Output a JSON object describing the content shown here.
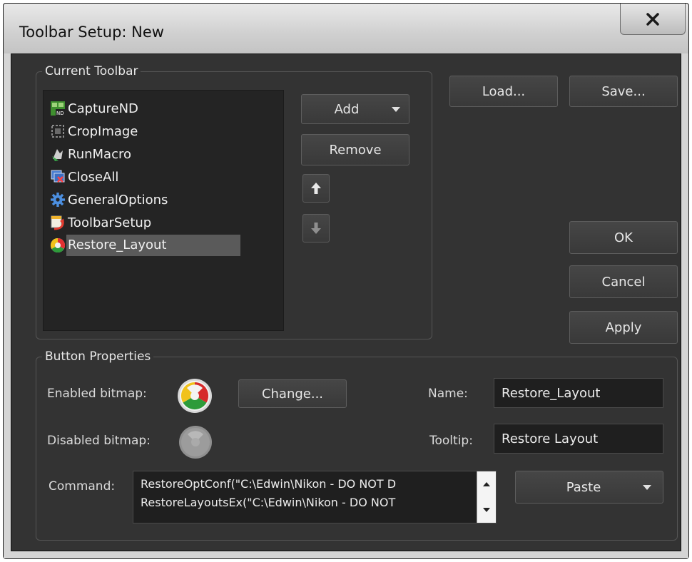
{
  "window": {
    "title": "Toolbar Setup: New",
    "close_label": "X"
  },
  "current_toolbar": {
    "group_label": "Current Toolbar",
    "items": [
      {
        "label": "CaptureND",
        "icon": "capture-nd-icon"
      },
      {
        "label": "CropImage",
        "icon": "crop-image-icon"
      },
      {
        "label": "RunMacro",
        "icon": "run-macro-icon"
      },
      {
        "label": "CloseAll",
        "icon": "close-all-icon"
      },
      {
        "label": "GeneralOptions",
        "icon": "gear-icon"
      },
      {
        "label": "ToolbarSetup",
        "icon": "toolbar-setup-icon"
      },
      {
        "label": "Restore_Layout",
        "icon": "restore-layout-icon",
        "selected": true
      }
    ],
    "add_label": "Add",
    "remove_label": "Remove"
  },
  "actions": {
    "load_label": "Load...",
    "save_label": "Save...",
    "ok_label": "OK",
    "cancel_label": "Cancel",
    "apply_label": "Apply"
  },
  "button_properties": {
    "group_label": "Button Properties",
    "enabled_bitmap_label": "Enabled bitmap:",
    "disabled_bitmap_label": "Disabled bitmap:",
    "change_label": "Change...",
    "name_label": "Name:",
    "name_value": "Restore_Layout",
    "tooltip_label": "Tooltip:",
    "tooltip_value": "Restore Layout",
    "command_label": "Command:",
    "command_lines": [
      "RestoreOptConf(\"C:\\Edwin\\Nikon - DO NOT D",
      "RestoreLayoutsEx(\"C:\\Edwin\\Nikon - DO NOT"
    ],
    "paste_label": "Paste"
  },
  "colors": {
    "dialog_bg": "#333333",
    "list_bg": "#242424",
    "selection": "#5a5a5a",
    "titlebar": "#d0d0d0"
  }
}
